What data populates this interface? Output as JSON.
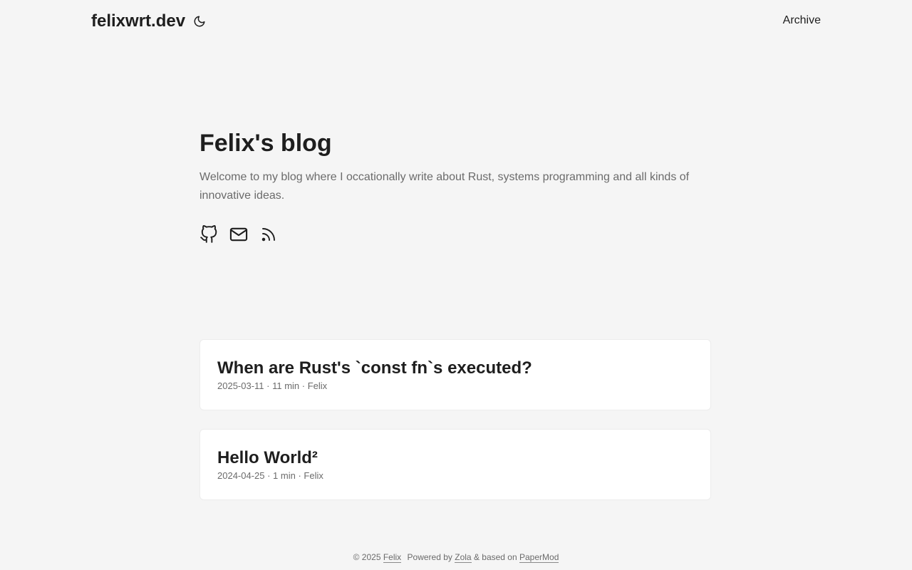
{
  "nav": {
    "site_title": "felixwrt.dev",
    "theme_toggle_icon": "moon-icon",
    "menu_items": [
      {
        "label": "Archive"
      }
    ]
  },
  "home": {
    "title": "Felix's blog",
    "subtitle": "Welcome to my blog where I occationally write about Rust, systems programming and all kinds of innovative ideas.",
    "social_icons": [
      "github-icon",
      "mail-icon",
      "rss-icon"
    ]
  },
  "posts": [
    {
      "title": "When are Rust's `const fn`s executed?",
      "date": "2025-03-11",
      "reading_time": "11 min",
      "author": "Felix",
      "meta": "2025-03-11 · 11 min · Felix"
    },
    {
      "title": "Hello World²",
      "date": "2024-04-25",
      "reading_time": "1 min",
      "author": "Felix",
      "meta": "2024-04-25 · 1 min · Felix"
    }
  ],
  "footer": {
    "copyright": "© 2025",
    "author_link": "Felix",
    "powered_by": "Powered by",
    "engine_link": "Zola",
    "based_on": "& based on",
    "theme_link": "PaperMod"
  },
  "colors": {
    "background": "#f5f5f5",
    "text": "#1e1e1e",
    "secondary": "#6b6b6b",
    "card": "#ffffff"
  }
}
